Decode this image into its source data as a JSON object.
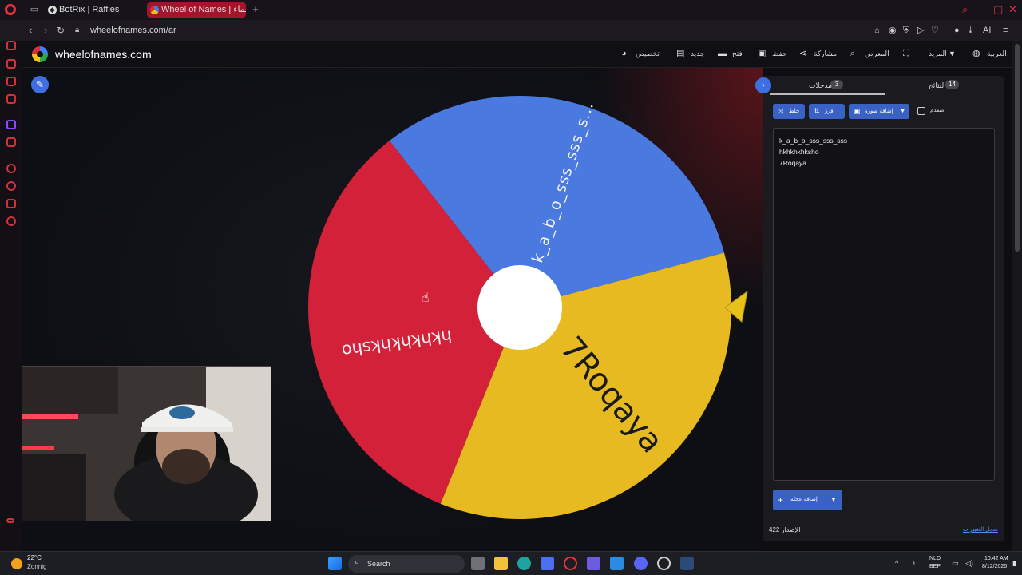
{
  "browser": {
    "tabs": [
      {
        "label": "BotRix | Raffles",
        "active": false
      },
      {
        "label": "Wheel of Names | عجلة الأسماء",
        "active": true
      }
    ],
    "new_tab": "+",
    "url": "wheelofnames.com/ar",
    "toolbar_ai": "AI",
    "icons": [
      "opera-logo",
      "workspaces-icon",
      "search-icon",
      "minimize-icon",
      "maximize-icon",
      "close-icon",
      "back-icon",
      "forward-icon",
      "reload-icon",
      "lock-icon",
      "heart-icon",
      "download-icon",
      "menu-icon"
    ]
  },
  "site": {
    "title": "wheelofnames.com",
    "menu": [
      {
        "label": "تخصيص",
        "icon": "palette-icon"
      },
      {
        "label": "جديد",
        "icon": "new-file-icon"
      },
      {
        "label": "فتح",
        "icon": "folder-icon"
      },
      {
        "label": "حفظ",
        "icon": "save-icon"
      },
      {
        "label": "مشاركة",
        "icon": "share-icon"
      },
      {
        "label": "المعرض",
        "icon": "search-icon"
      },
      {
        "label": "",
        "icon": "fullscreen-icon"
      },
      {
        "label": "المزيد",
        "icon": "caret-down-icon"
      },
      {
        "label": "العربية",
        "icon": "globe-icon"
      }
    ]
  },
  "wheel": {
    "segments": [
      {
        "label": "k_a_b_o_sss_sss_s...",
        "color": "#4a79e0"
      },
      {
        "label": "7Roqaya",
        "color": "#e8ba22"
      },
      {
        "label": "hkhkhkhksho",
        "color": "#d3213a"
      }
    ],
    "pointer_color": "#e6c21a"
  },
  "panel": {
    "tabs": [
      {
        "label": "مدخلات",
        "count": "3",
        "active": true
      },
      {
        "label": "النتائج",
        "count": "14",
        "active": false
      }
    ],
    "buttons": {
      "shuffle": "خلط",
      "sort": "فرز",
      "add_image": "إضافة صورة"
    },
    "advanced_label": "متقدم",
    "entries": [
      "k_a_b_o_sss_sss_sss",
      "hkhkhkhksho",
      "7Roqaya"
    ],
    "add_wheel": "إضافة عجلة",
    "version_label": "الإصدار",
    "version_number": "422",
    "changelog": "سجل التغييرات"
  },
  "taskbar": {
    "temperature": "22°C",
    "weather": "Zonnig",
    "search_label": "Search",
    "lang_line1": "NLD",
    "lang_line2": "BEP",
    "time": "10:42 AM",
    "date": "8/12/2026"
  },
  "colors": {
    "accent": "#3d6fe0",
    "opera_red": "#e5323c"
  }
}
